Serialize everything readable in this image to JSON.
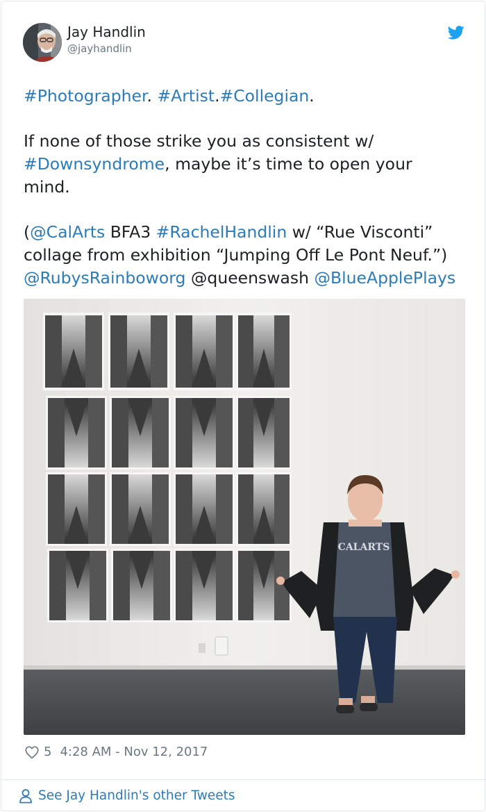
{
  "author": {
    "name": "Jay Handlin",
    "handle": "@jayhandlin"
  },
  "icons": {
    "brand": "twitter-bird-icon",
    "like": "heart-icon",
    "profile": "person-icon"
  },
  "colors": {
    "link": "#2b7bb9",
    "text": "#1c2022",
    "muted": "#697882",
    "twitter_blue": "#1da1f2",
    "border": "#e1e8ed"
  },
  "tweet": {
    "line1": {
      "tag_photographer": "#Photographer",
      "dot1": ". ",
      "tag_artist": "#Artist",
      "dot2": ".",
      "tag_collegian": "#Collegian",
      "dot3": "."
    },
    "line2": {
      "text": "If none of those strike you as consistent w/"
    },
    "line3": {
      "tag_downsyndrome": "#Downsyndrome",
      "text": ", maybe it’s time to open your"
    },
    "line4": {
      "text": "mind."
    },
    "line5": {
      "open_paren": "(",
      "mention_calarts": "@CalArts",
      "bfa": " BFA3 ",
      "tag_rachel": "#RachelHandlin",
      "text": " w/ “Rue Visconti”"
    },
    "line6": {
      "text": "collage from exhibition “Jumping Off Le Pont Neuf.”)"
    },
    "line7": {
      "mention_rubys": "@RubysRainboworg",
      "mention_queens": " @queenswash ",
      "mention_blueapple": "@BlueApplePlays"
    }
  },
  "meta": {
    "likes": "5",
    "timestamp": "4:28 AM - Nov 12, 2017"
  },
  "footer": {
    "link_label": "See Jay Handlin's other Tweets"
  }
}
